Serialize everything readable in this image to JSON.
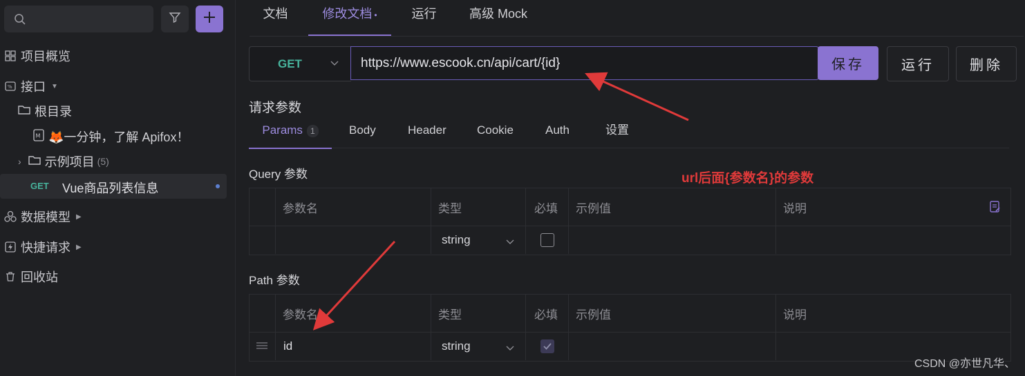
{
  "sidebar": {
    "nav": {
      "overview": "项目概览",
      "interfaces": "接口",
      "data_models": "数据模型",
      "quick_requests": "快捷请求",
      "recycle": "回收站"
    },
    "tree": {
      "root": "根目录",
      "doc_item": "🦊一分钟，了解 Apifox！",
      "example": "示例项目",
      "example_count": "(5)",
      "api_method": "GET",
      "api_name": "Vue商品列表信息"
    }
  },
  "tabs": {
    "doc": "文档",
    "edit": "修改文档",
    "edit_marker": "•",
    "run": "运行",
    "mock": "高级 Mock"
  },
  "request": {
    "method": "GET",
    "url": "https://www.escook.cn/api/cart/{id}",
    "save": "保存",
    "run": "运行",
    "delete": "删除"
  },
  "params_section": {
    "title": "请求参数",
    "tabs": [
      "Params",
      "Body",
      "Header",
      "Cookie",
      "Auth",
      "设置"
    ],
    "params_count": "1"
  },
  "query": {
    "title": "Query 参数",
    "headers": {
      "name": "参数名",
      "type": "类型",
      "required": "必填",
      "example": "示例值",
      "desc": "说明"
    },
    "row": {
      "type": "string"
    }
  },
  "path": {
    "title": "Path 参数",
    "headers": {
      "name": "参数名",
      "type": "类型",
      "required": "必填",
      "example": "示例值",
      "desc": "说明"
    },
    "row": {
      "name": "id",
      "type": "string"
    }
  },
  "annotation": "url后面{参数名}的参数",
  "watermark": "CSDN @亦世凡华、"
}
